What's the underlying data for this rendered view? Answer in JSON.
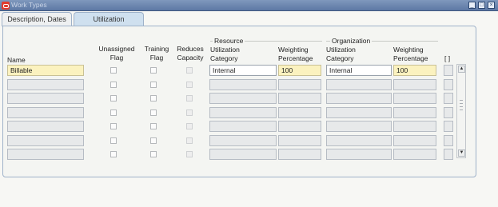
{
  "window": {
    "title": "Work Types"
  },
  "tabs": [
    {
      "label": "Description, Dates"
    },
    {
      "label": "Utilization"
    }
  ],
  "headers": {
    "name": "Name",
    "unassigned": [
      "Unassigned",
      "Flag"
    ],
    "training": [
      "Training",
      "Flag"
    ],
    "reduces": [
      "Reduces",
      "Capacity"
    ],
    "resource_group": "Resource",
    "res_category": [
      "Utilization",
      "Category"
    ],
    "res_weight": [
      "Weighting",
      "Percentage"
    ],
    "org_group": "Organization",
    "org_category": [
      "Utilization",
      "Category"
    ],
    "org_weight": [
      "Weighting",
      "Percentage"
    ],
    "select_col": "[ ]"
  },
  "rows": [
    {
      "name": "Billable",
      "res_category": "Internal",
      "res_weight": "100",
      "org_category": "Internal",
      "org_weight": "100"
    },
    {
      "name": "",
      "res_category": "",
      "res_weight": "",
      "org_category": "",
      "org_weight": ""
    },
    {
      "name": "",
      "res_category": "",
      "res_weight": "",
      "org_category": "",
      "org_weight": ""
    },
    {
      "name": "",
      "res_category": "",
      "res_weight": "",
      "org_category": "",
      "org_weight": ""
    },
    {
      "name": "",
      "res_category": "",
      "res_weight": "",
      "org_category": "",
      "org_weight": ""
    },
    {
      "name": "",
      "res_category": "",
      "res_weight": "",
      "org_category": "",
      "org_weight": ""
    },
    {
      "name": "",
      "res_category": "",
      "res_weight": "",
      "org_category": "",
      "org_weight": ""
    }
  ],
  "window_buttons": {
    "minimize": "_",
    "maximize": "□",
    "close": "×"
  },
  "scroll": {
    "up": "▲",
    "down": "▼"
  }
}
